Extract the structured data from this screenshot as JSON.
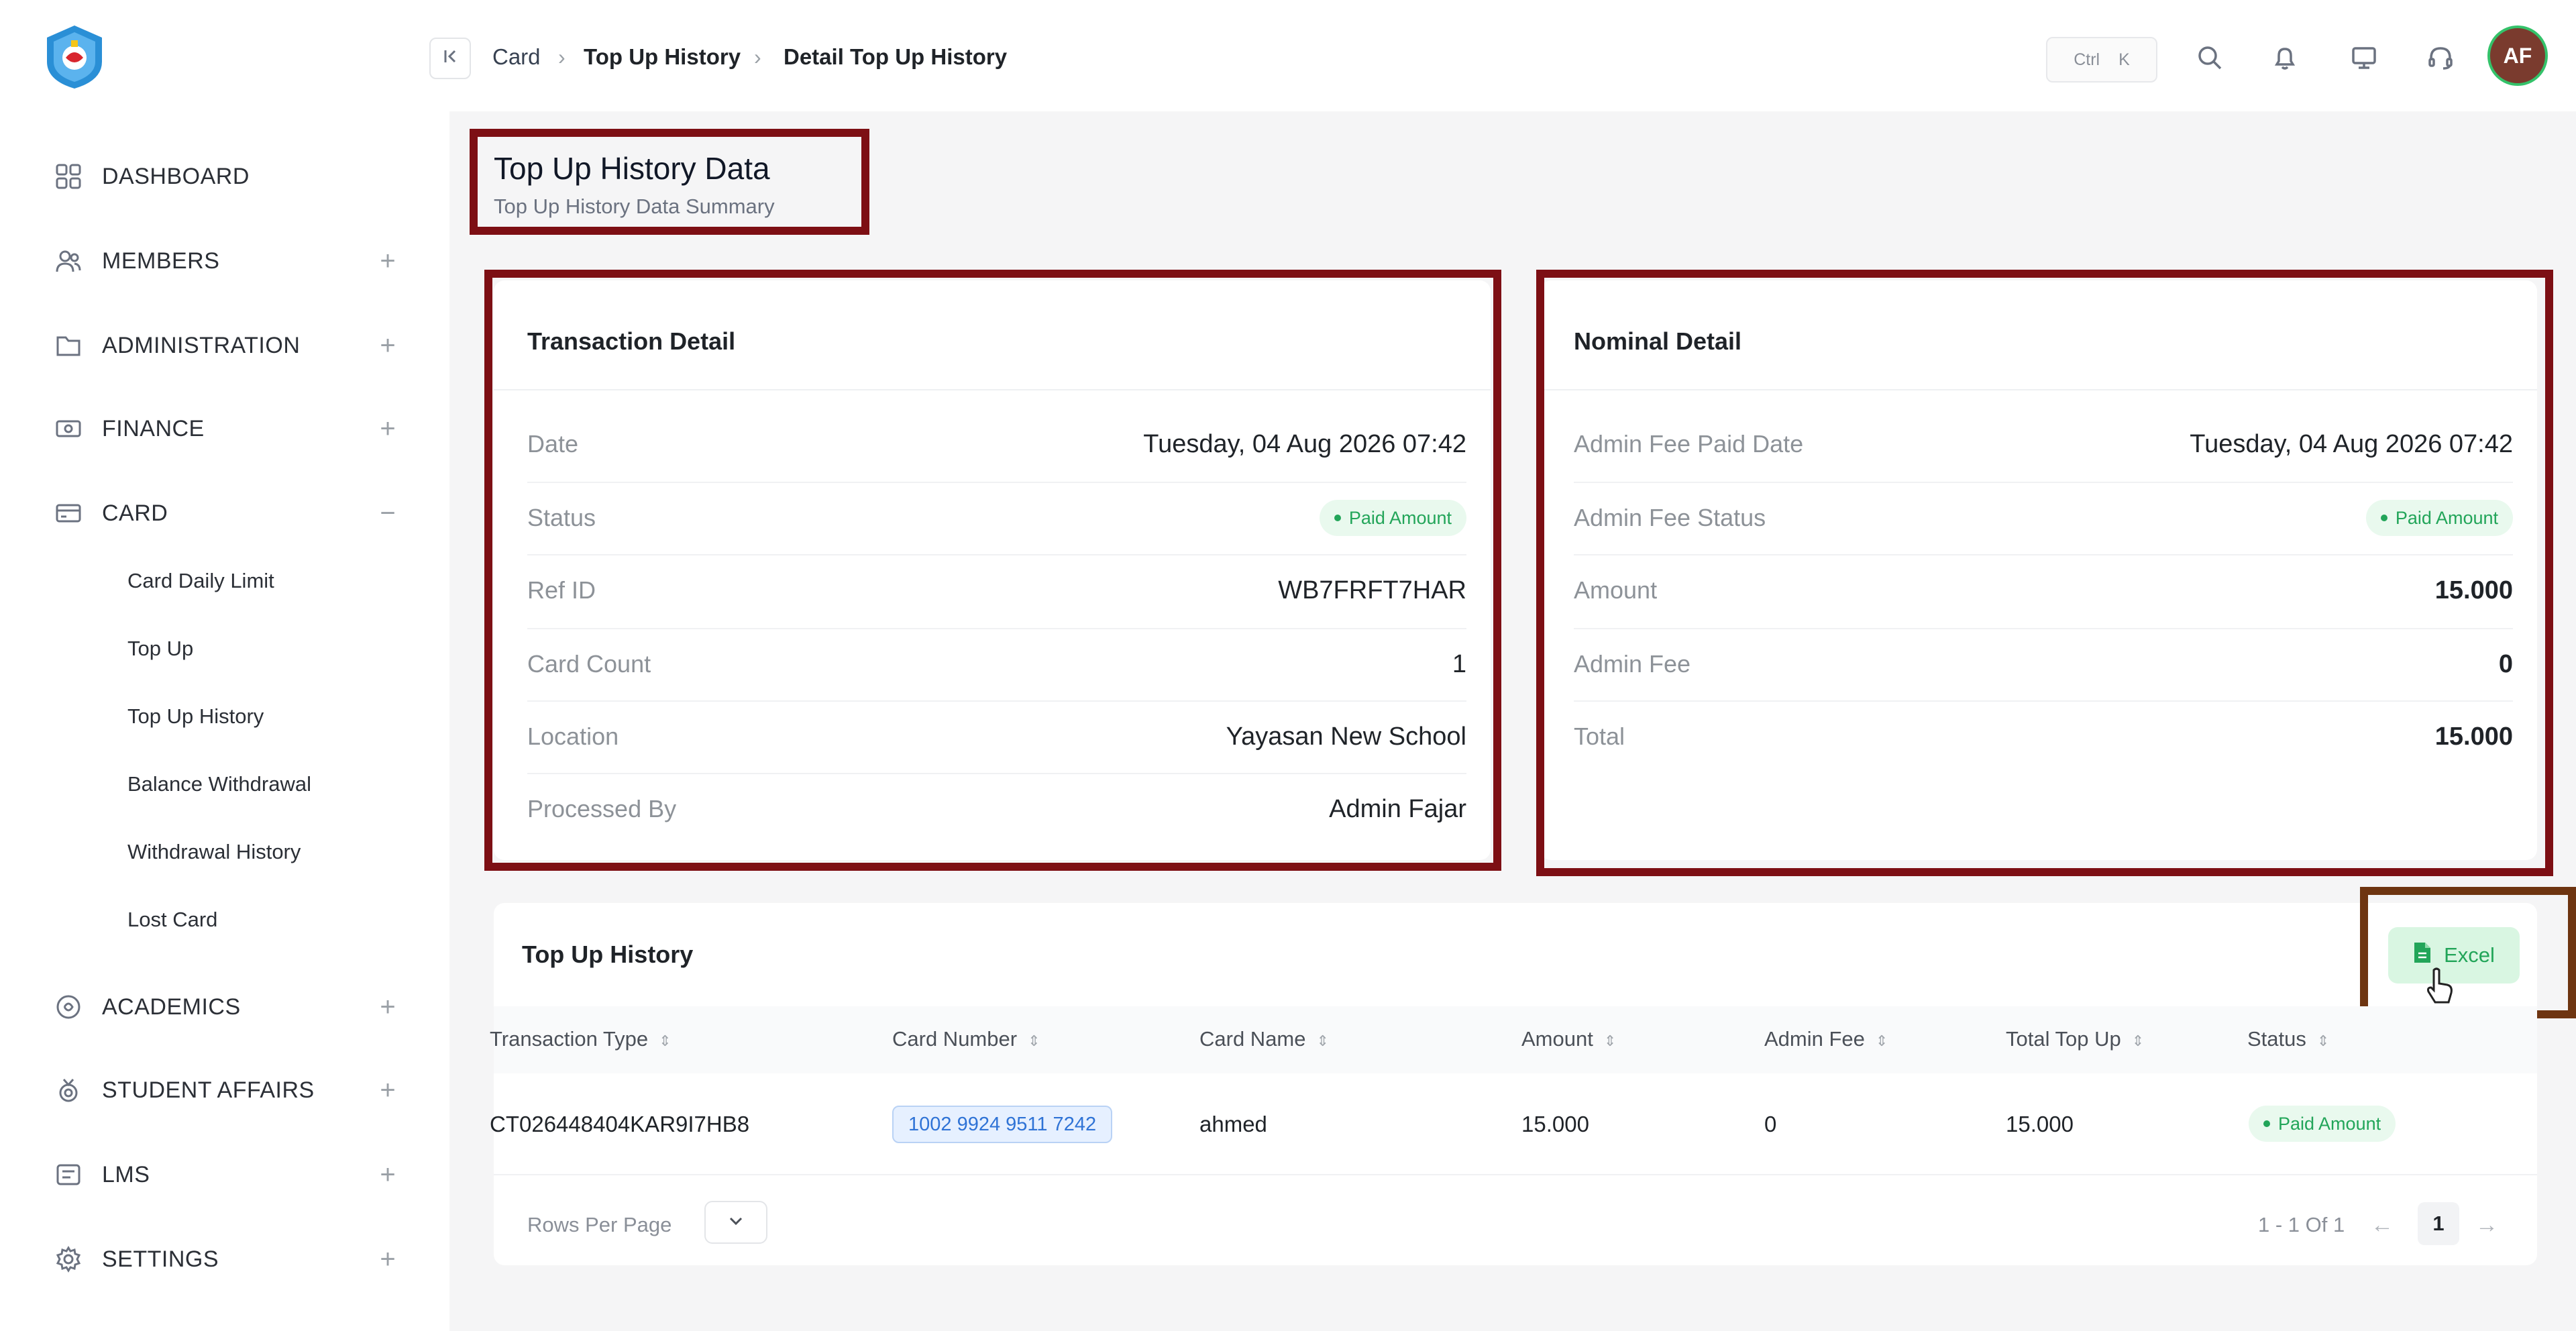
{
  "sidebar": {
    "items": [
      {
        "label": "DASHBOARD",
        "toggle": ""
      },
      {
        "label": "MEMBERS",
        "toggle": "+"
      },
      {
        "label": "ADMINISTRATION",
        "toggle": "+"
      },
      {
        "label": "FINANCE",
        "toggle": "+"
      },
      {
        "label": "CARD",
        "toggle": "−"
      },
      {
        "label": "ACADEMICS",
        "toggle": "+"
      },
      {
        "label": "STUDENT AFFAIRS",
        "toggle": "+"
      },
      {
        "label": "LMS",
        "toggle": "+"
      },
      {
        "label": "SETTINGS",
        "toggle": "+"
      }
    ],
    "card_submenu": [
      "Card Daily Limit",
      "Top Up",
      "Top Up History",
      "Balance Withdrawal",
      "Withdrawal History",
      "Lost Card"
    ]
  },
  "topbar": {
    "breadcrumb": [
      "Card",
      "Top Up History",
      "Detail Top Up History"
    ],
    "shortcut_ctrl": "Ctrl",
    "shortcut_key": "K",
    "avatar_initials": "AF"
  },
  "page": {
    "title": "Top Up History Data",
    "subtitle": "Top Up History Data Summary"
  },
  "transaction_detail": {
    "title": "Transaction Detail",
    "rows": [
      {
        "label": "Date",
        "value": "Tuesday, 04 Aug 2026 07:42"
      },
      {
        "label": "Status",
        "value": "Paid Amount"
      },
      {
        "label": "Ref ID",
        "value": "WB7FRFT7HAR"
      },
      {
        "label": "Card Count",
        "value": "1"
      },
      {
        "label": "Location",
        "value": "Yayasan New School"
      },
      {
        "label": "Processed By",
        "value": "Admin Fajar"
      }
    ]
  },
  "nominal_detail": {
    "title": "Nominal Detail",
    "rows": [
      {
        "label": "Admin Fee Paid Date",
        "value": "Tuesday, 04 Aug 2026 07:42"
      },
      {
        "label": "Admin Fee Status",
        "value": "Paid Amount"
      },
      {
        "label": "Amount",
        "value": "15.000"
      },
      {
        "label": "Admin Fee",
        "value": "0"
      },
      {
        "label": "Total",
        "value": "15.000"
      }
    ]
  },
  "history": {
    "title": "Top Up History",
    "excel_label": "Excel",
    "columns": [
      "Transaction Type",
      "Card Number",
      "Card Name",
      "Amount",
      "Admin Fee",
      "Total Top Up",
      "Status"
    ],
    "rows": [
      {
        "transaction_type": "CT026448404KAR9I7HB8",
        "card_number": "1002 9924 9511 7242",
        "card_name": "ahmed",
        "amount": "15.000",
        "admin_fee": "0",
        "total_top_up": "15.000",
        "status": "Paid Amount"
      }
    ],
    "rows_per_page_label": "Rows Per Page",
    "pagination_info": "1 - 1 Of 1",
    "current_page": "1",
    "prev_arrow": "←",
    "next_arrow": "→"
  },
  "colors": {
    "highlight": "#7d0f14",
    "highlight_excel": "#6e3511",
    "status_green": "#22a559",
    "avatar_bg": "#7a3b2e"
  }
}
